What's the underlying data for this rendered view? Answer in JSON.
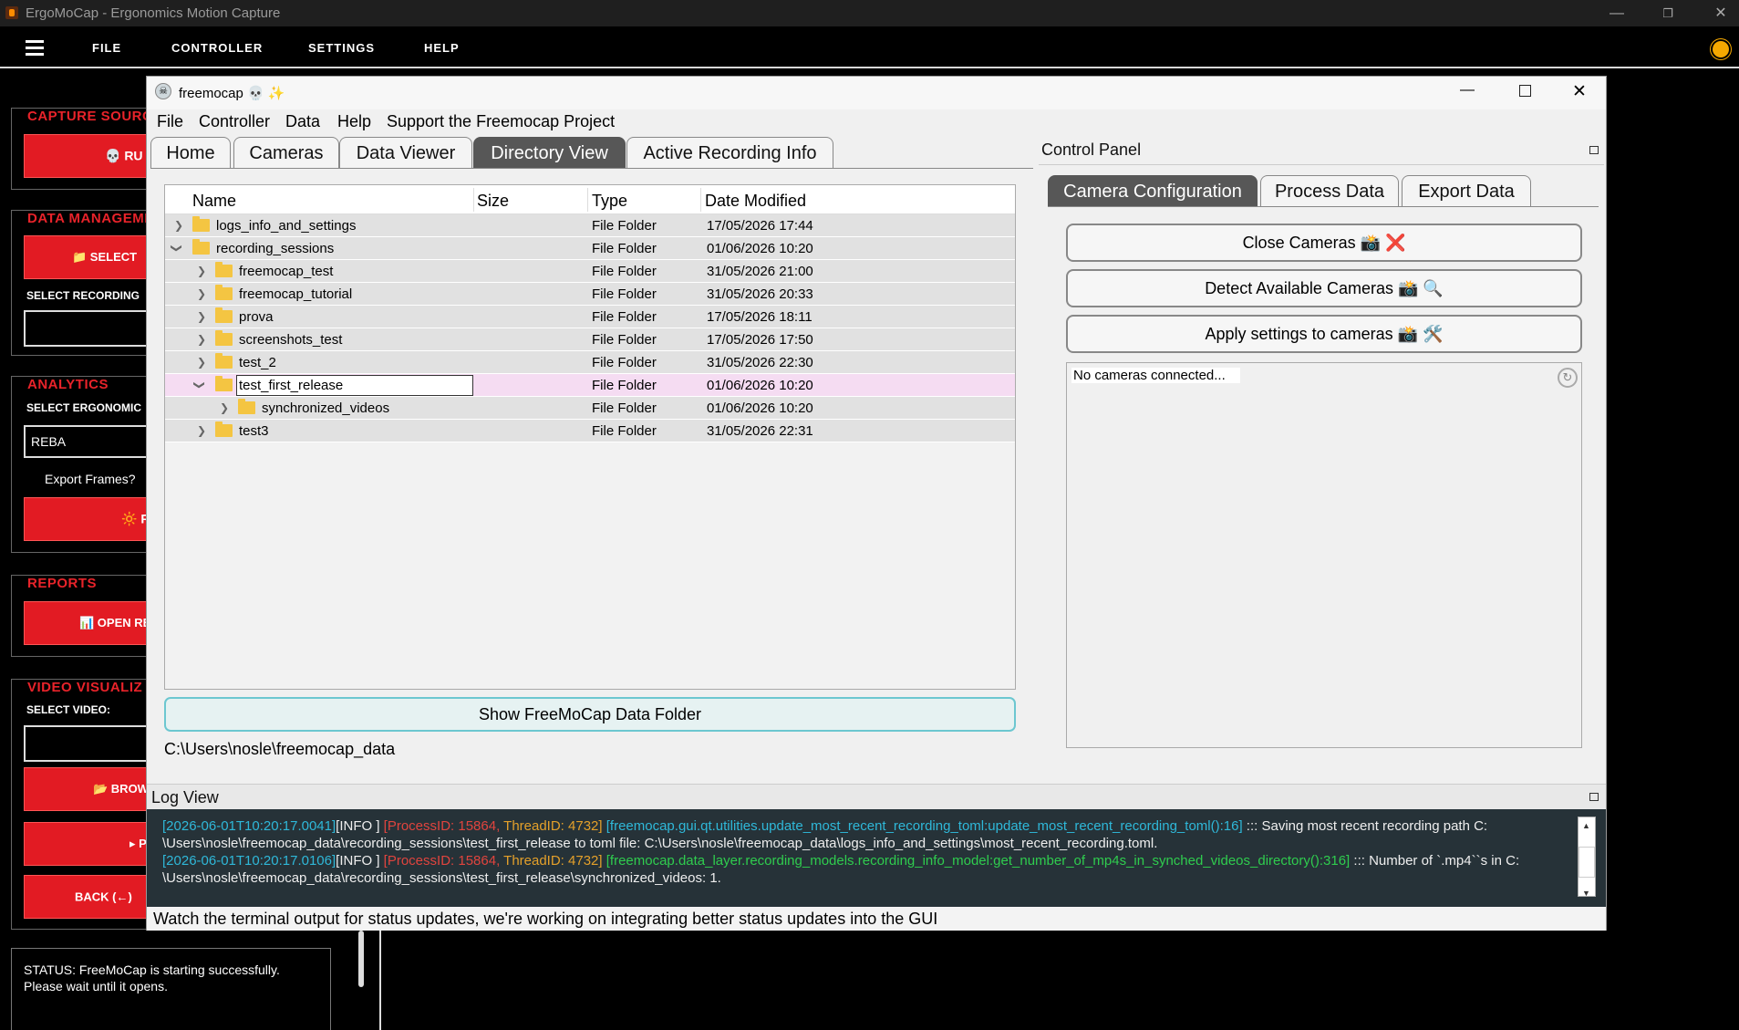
{
  "app": {
    "title": "ErgoMoCap - Ergonomics Motion Capture",
    "menu": [
      "FILE",
      "CONTROLLER",
      "SETTINGS",
      "HELP"
    ]
  },
  "sidebar": {
    "capture": {
      "head": "CAPTURE SOURC",
      "btn": "💀 RU"
    },
    "data": {
      "head": "DATA MANAGEME",
      "btn": "📁 SELECT",
      "label": "SELECT RECORDING"
    },
    "analytics": {
      "head": "ANALYTICS",
      "label": "SELECT ERGONOMIC",
      "value": "REBA",
      "export": "Export Frames?",
      "btn": "🔆 RU"
    },
    "reports": {
      "head": "REPORTS",
      "btn": "📊 OPEN RE"
    },
    "video": {
      "head": "VIDEO VISUALIZ",
      "label": "SELECT VIDEO:",
      "browse": "📂 BROW",
      "play": "▸ PL",
      "back": "BACK (←)"
    },
    "status": "STATUS: FreeMoCap is starting successfully. Please wait until it opens."
  },
  "fm": {
    "title": "freemocap 💀 ✨",
    "menu": [
      "File",
      "Controller",
      "Data",
      "Help",
      "Support the Freemocap Project"
    ],
    "tabs": [
      "Home",
      "Cameras",
      "Data Viewer",
      "Directory View",
      "Active Recording Info"
    ],
    "tree": {
      "columns": [
        "Name",
        "Size",
        "Type",
        "Date Modified"
      ],
      "rows": [
        {
          "name": "logs_info_and_settings",
          "type": "File Folder",
          "date": "17/05/2026 17:44"
        },
        {
          "name": "recording_sessions",
          "type": "File Folder",
          "date": "01/06/2026 10:20"
        },
        {
          "name": "freemocap_test",
          "type": "File Folder",
          "date": "31/05/2026 21:00"
        },
        {
          "name": "freemocap_tutorial",
          "type": "File Folder",
          "date": "31/05/2026 20:33"
        },
        {
          "name": "prova",
          "type": "File Folder",
          "date": "17/05/2026 18:11"
        },
        {
          "name": "screenshots_test",
          "type": "File Folder",
          "date": "17/05/2026 17:50"
        },
        {
          "name": "test_2",
          "type": "File Folder",
          "date": "31/05/2026 22:30"
        },
        {
          "name": "test_first_release",
          "type": "File Folder",
          "date": "01/06/2026 10:20"
        },
        {
          "name": "synchronized_videos",
          "type": "File Folder",
          "date": "01/06/2026 10:20"
        },
        {
          "name": "test3",
          "type": "File Folder",
          "date": "31/05/2026 22:31"
        }
      ]
    },
    "show_folder": "Show FreeMoCap Data Folder",
    "path": "C:\\Users\\nosle\\freemocap_data",
    "control_panel": {
      "title": "Control Panel",
      "tabs": [
        "Camera Configuration",
        "Process Data",
        "Export Data"
      ],
      "buttons": [
        "Close Cameras 📸 ❌",
        "Detect Available Cameras 📸 🔍",
        "Apply settings to cameras 📸 🛠️"
      ],
      "cameras": "No cameras connected..."
    },
    "log": {
      "title": "Log View",
      "lines": [
        {
          "ts": "[2026-06-01T10:20:17.0041]",
          "lvl": "[INFO ]",
          "pid": "[ProcessID: 15864,",
          "tid": "ThreadID: 4732]",
          "mod": "[freemocap.gui.qt.utilities.update_most_recent_recording_toml:update_most_recent_recording_toml():16]",
          "msg": "::: Saving most recent recording path C:",
          "cont": "\\Users\\nosle\\freemocap_data\\recording_sessions\\test_first_release to toml file: C:\\Users\\nosle\\freemocap_data\\logs_info_and_settings\\most_recent_recording.toml."
        },
        {
          "ts": "[2026-06-01T10:20:17.0106]",
          "lvl": "[INFO ]",
          "pid": "[ProcessID: 15864,",
          "tid": "ThreadID: 4732]",
          "mod": "[freemocap.data_layer.recording_models.recording_info_model:get_number_of_mp4s_in_synched_videos_directory():316]",
          "msg": "::: Number of `.mp4``s in C:",
          "cont": "\\Users\\nosle\\freemocap_data\\recording_sessions\\test_first_release\\synchronized_videos: 1."
        }
      ]
    },
    "footer": "Watch the terminal output for status updates, we're working on integrating better status updates into the GUI"
  }
}
